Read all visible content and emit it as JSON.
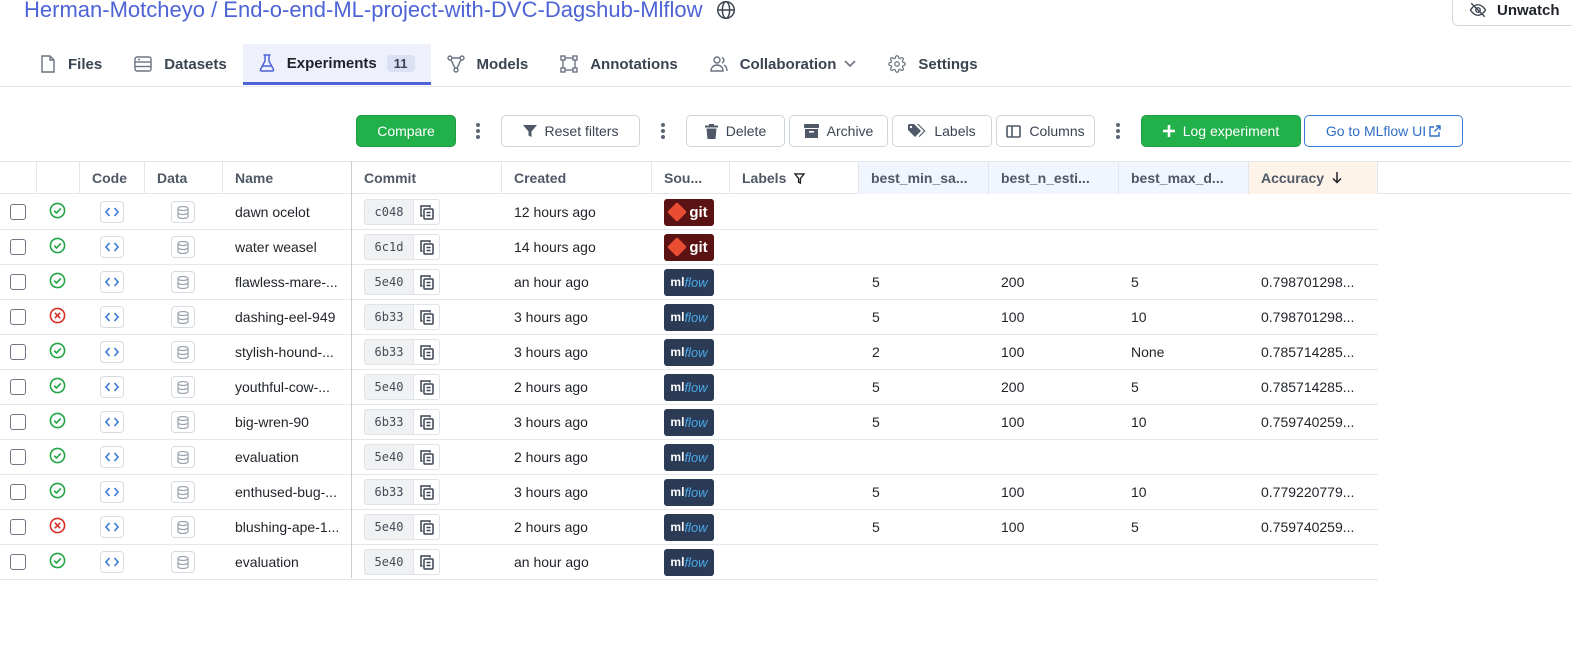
{
  "header": {
    "repo_title": "Herman-Motcheyo / End-o-end-ML-project-with-DVC-Dagshub-Mlflow",
    "unwatch_label": "Unwatch"
  },
  "tabs": [
    {
      "label": "Files",
      "icon": "file-icon"
    },
    {
      "label": "Datasets",
      "icon": "database-icon"
    },
    {
      "label": "Experiments",
      "icon": "flask-icon",
      "count": "11",
      "active": true
    },
    {
      "label": "Models",
      "icon": "models-icon"
    },
    {
      "label": "Annotations",
      "icon": "annotations-icon"
    },
    {
      "label": "Collaboration",
      "icon": "people-icon"
    },
    {
      "label": "Settings",
      "icon": "gear-icon"
    }
  ],
  "toolbar": {
    "compare": "Compare",
    "reset_filters": "Reset filters",
    "delete": "Delete",
    "archive": "Archive",
    "labels": "Labels",
    "columns": "Columns",
    "log_experiment": "Log experiment",
    "mlflow_ui": "Go to MLflow UI"
  },
  "columns": {
    "code": "Code",
    "data": "Data",
    "name": "Name",
    "commit": "Commit",
    "created": "Created",
    "source": "Sou...",
    "labels": "Labels",
    "best_min_samples": "best_min_sa...",
    "best_n_estimators": "best_n_esti...",
    "best_max_depth": "best_max_d...",
    "accuracy": "Accuracy"
  },
  "colors": {
    "accent": "#4d63d6",
    "green": "#22b04b",
    "success": "#22a447",
    "failure": "#d93025"
  },
  "rows": [
    {
      "status": "success",
      "name": "dawn ocelot",
      "commit": "c048",
      "created": "12 hours ago",
      "source": "git",
      "min_samples": "",
      "n_estimators": "",
      "max_depth": "",
      "accuracy": ""
    },
    {
      "status": "success",
      "name": "water weasel",
      "commit": "6c1d",
      "created": "14 hours ago",
      "source": "git",
      "min_samples": "",
      "n_estimators": "",
      "max_depth": "",
      "accuracy": ""
    },
    {
      "status": "success",
      "name": "flawless-mare-...",
      "commit": "5e40",
      "created": "an hour ago",
      "source": "mlflow",
      "min_samples": "5",
      "n_estimators": "200",
      "max_depth": "5",
      "accuracy": "0.798701298..."
    },
    {
      "status": "failed",
      "name": "dashing-eel-949",
      "commit": "6b33",
      "created": "3 hours ago",
      "source": "mlflow",
      "min_samples": "5",
      "n_estimators": "100",
      "max_depth": "10",
      "accuracy": "0.798701298..."
    },
    {
      "status": "success",
      "name": "stylish-hound-...",
      "commit": "6b33",
      "created": "3 hours ago",
      "source": "mlflow",
      "min_samples": "2",
      "n_estimators": "100",
      "max_depth": "None",
      "accuracy": "0.785714285..."
    },
    {
      "status": "success",
      "name": "youthful-cow-...",
      "commit": "5e40",
      "created": "2 hours ago",
      "source": "mlflow",
      "min_samples": "5",
      "n_estimators": "200",
      "max_depth": "5",
      "accuracy": "0.785714285..."
    },
    {
      "status": "success",
      "name": "big-wren-90",
      "commit": "6b33",
      "created": "3 hours ago",
      "source": "mlflow",
      "min_samples": "5",
      "n_estimators": "100",
      "max_depth": "10",
      "accuracy": "0.759740259..."
    },
    {
      "status": "success",
      "name": "evaluation",
      "commit": "5e40",
      "created": "2 hours ago",
      "source": "mlflow",
      "min_samples": "",
      "n_estimators": "",
      "max_depth": "",
      "accuracy": ""
    },
    {
      "status": "success",
      "name": "enthused-bug-...",
      "commit": "6b33",
      "created": "3 hours ago",
      "source": "mlflow",
      "min_samples": "5",
      "n_estimators": "100",
      "max_depth": "10",
      "accuracy": "0.779220779..."
    },
    {
      "status": "failed",
      "name": "blushing-ape-1...",
      "commit": "5e40",
      "created": "2 hours ago",
      "source": "mlflow",
      "min_samples": "5",
      "n_estimators": "100",
      "max_depth": "5",
      "accuracy": "0.759740259..."
    },
    {
      "status": "success",
      "name": "evaluation",
      "commit": "5e40",
      "created": "an hour ago",
      "source": "mlflow",
      "min_samples": "",
      "n_estimators": "",
      "max_depth": "",
      "accuracy": ""
    }
  ],
  "source_badge": {
    "git": "git",
    "ml": "ml",
    "flow": "flow"
  }
}
